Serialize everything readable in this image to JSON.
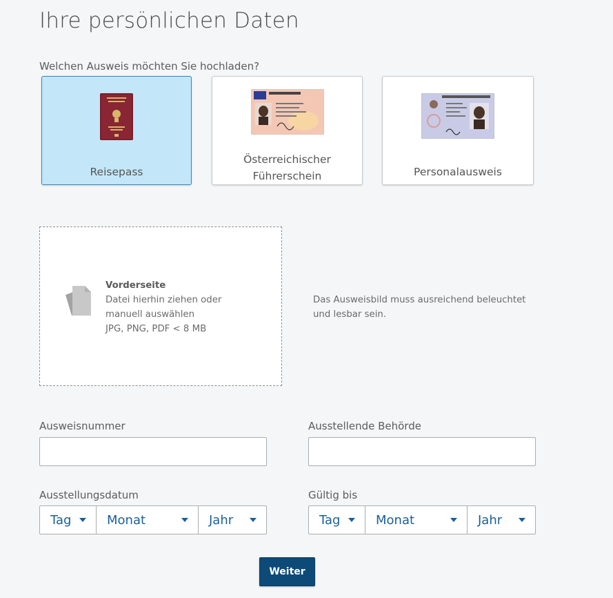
{
  "page": {
    "title": "Ihre persönlichen Daten",
    "question": "Welchen Ausweis möchten Sie hochladen?"
  },
  "id_types": [
    {
      "label": "Reisepass",
      "selected": true
    },
    {
      "label_line1": "Österreichischer",
      "label_line2": "Führerschein",
      "selected": false
    },
    {
      "label": "Personalausweis",
      "selected": false
    }
  ],
  "dropzone": {
    "title": "Vorderseite",
    "line1": "Datei hierhin ziehen oder",
    "line2": "manuell auswählen",
    "formats": "JPG, PNG, PDF < 8 MB",
    "icon": "document-stack-icon"
  },
  "hint": {
    "line1": "Das Ausweisbild muss ausreichend beleuchtet",
    "line2": "und lesbar sein."
  },
  "form": {
    "id_number_label": "Ausweisnummer",
    "id_number_value": "",
    "authority_label": "Ausstellende Behörde",
    "authority_value": "",
    "issue_date_label": "Ausstellungsdatum",
    "valid_until_label": "Gültig bis",
    "day_label": "Tag",
    "month_label": "Monat",
    "year_label": "Jahr"
  },
  "submit_label": "Weiter",
  "colors": {
    "selected_card_bg": "#c3e6f8",
    "selected_card_border": "#2f87bf",
    "link_blue": "#1a5f9a",
    "button_bg": "#0d4a78"
  }
}
